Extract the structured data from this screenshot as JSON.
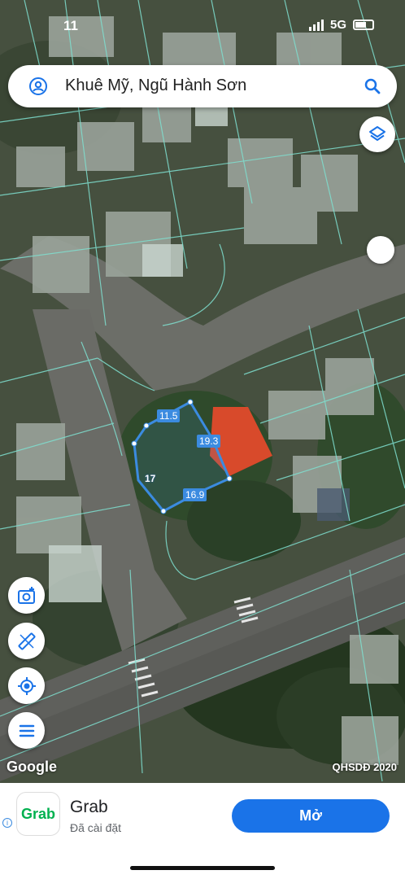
{
  "status_bar": {
    "time": "11",
    "network": "5G"
  },
  "search": {
    "text": "Khuê Mỹ, Ngũ Hành Sơn"
  },
  "measurements": [
    {
      "id": "top",
      "value": "11.5"
    },
    {
      "id": "right",
      "value": "19.3"
    },
    {
      "id": "left",
      "value": "17"
    },
    {
      "id": "bottom",
      "value": "16.9"
    }
  ],
  "map": {
    "attribution": "Google",
    "credit": "QHSDĐ 2020"
  },
  "ad": {
    "app_name": "Grab",
    "logo_text": "Grab",
    "status": "Đã cài đặt",
    "button_label": "Mở",
    "info_glyph": "i"
  },
  "icons": [
    "user-icon",
    "search-icon",
    "layers-icon",
    "camera-add-icon",
    "ruler-icon",
    "my-location-icon",
    "menu-icon"
  ],
  "colors": {
    "accent": "#1a73e8",
    "parcel_lines": "#7fe0d0",
    "measure_line": "#3b8be0",
    "roof_red": "#d84a2b",
    "grab_green": "#00b14f"
  }
}
